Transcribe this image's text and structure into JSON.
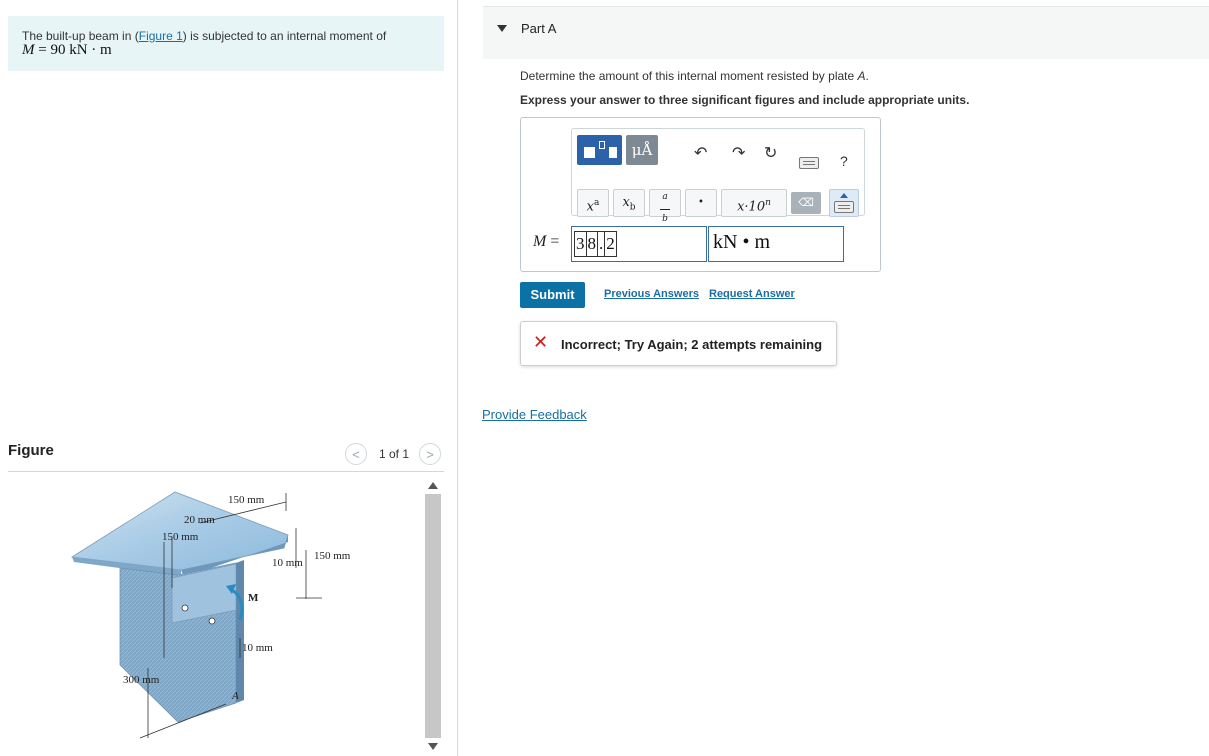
{
  "problem": {
    "text_before": "The built-up beam in (",
    "figure_link": "Figure 1",
    "text_after": ") is subjected to an internal moment of",
    "moment_symbol": "M",
    "moment_value": " = 90 kN · m"
  },
  "figure": {
    "title": "Figure",
    "page_count": "1 of 1",
    "prev_icon": "chevron-left-icon",
    "next_icon": "chevron-right-icon",
    "labels": {
      "top_150": "150 mm",
      "thick_20": "20 mm",
      "left_150": "150 mm",
      "right_150": "150 mm",
      "web_10": "10 mm",
      "flange_10": "10 mm",
      "height_300": "300 mm",
      "moment": "M",
      "plate": "A"
    }
  },
  "part": {
    "title": "Part A",
    "question_prefix": "Determine the amount of this internal moment resisted by plate ",
    "question_plate": "A",
    "question_suffix": ".",
    "instruction": "Express your answer to three significant figures and include appropriate units."
  },
  "toolbar": {
    "units_button": "μÅ",
    "undo_icon": "undo-icon",
    "redo_icon": "redo-icon",
    "reset_icon": "reset-icon",
    "keyboard_icon": "keyboard-icon",
    "help": "?",
    "superscript": "x",
    "superscript_exp": "a",
    "subscript": "x",
    "subscript_sub": "b",
    "fraction_num": "a",
    "fraction_den": "b",
    "dot": "•",
    "sci": "x·10",
    "sci_exp": "n",
    "backspace": "⌫"
  },
  "answer": {
    "label": "M",
    "equals": " =",
    "digits": [
      "3",
      "8",
      ".",
      "2"
    ],
    "unit": "kN • m"
  },
  "actions": {
    "submit": "Submit",
    "previous_answers": "Previous Answers",
    "request_answer": "Request Answer"
  },
  "feedback": {
    "icon": "x-icon",
    "message": "Incorrect; Try Again; 2 attempts remaining"
  },
  "provide_feedback": "Provide Feedback",
  "colors": {
    "accent": "#0b72a5",
    "problem_bg": "#e7f5f7",
    "error": "#c8201c",
    "toolbar_blue": "#2c62aa"
  }
}
